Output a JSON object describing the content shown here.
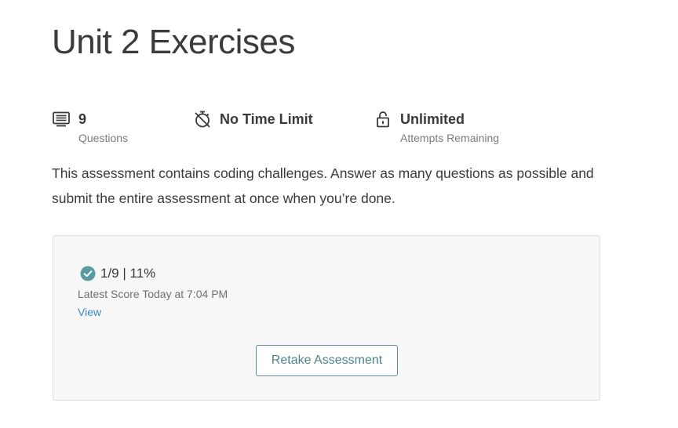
{
  "page": {
    "title": "Unit 2 Exercises"
  },
  "meta": {
    "questions": {
      "icon": "list-icon",
      "value": "9",
      "caption": "Questions"
    },
    "time": {
      "icon": "stopwatch-off-icon",
      "value": "No Time Limit"
    },
    "attempts": {
      "icon": "unlock-icon",
      "value": "Unlimited",
      "caption": "Attempts Remaining"
    }
  },
  "description": "This assessment contains coding challenges. Answer as many questions as possible and submit the entire assessment at once when you’re done.",
  "score_card": {
    "status_icon": "check-circle-icon",
    "score": "1/9 | 11%",
    "label": "Latest Score Today at 7:04 PM",
    "view_link": "View",
    "retake_button": "Retake Assessment"
  },
  "colors": {
    "accent_teal": "#5b8f94",
    "link_blue": "#3b86c6",
    "check_teal": "#5a9aa1",
    "card_bg": "#f7f7f7"
  }
}
